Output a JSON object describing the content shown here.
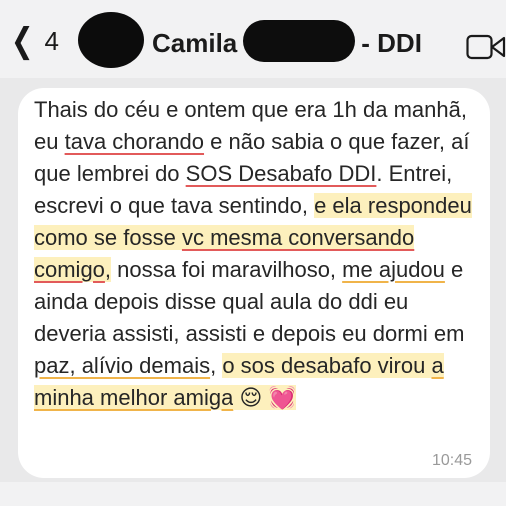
{
  "header": {
    "unread_count": "4",
    "contact_name_prefix": "Camila",
    "contact_name_suffix": "- DDI",
    "back_icon": "chevron-left-icon",
    "video_icon": "video-call-icon"
  },
  "message": {
    "seg1": "Thais do céu e ontem que era 1h da manhã, eu ",
    "seg2": "tava chorando",
    "seg3": " e não sabia o que fazer, aí que lembrei do ",
    "seg4": "SOS Desabafo DDI",
    "seg5": ". Entrei, escrevi o que tava sentindo, ",
    "seg6": "e ela respondeu como se fosse ",
    "seg7": "vc mesma conversando comigo",
    "seg8": ",",
    "seg9": " nossa foi maravilhoso, ",
    "seg10": "me ajudou",
    "seg11": " e ainda depois disse qual aula do ddi eu deveria assisti, assisti e depois eu dormi em ",
    "seg12": "paz, alívio demais",
    "seg13": ", ",
    "seg14": "o sos desabafo virou ",
    "seg15": "a minha melhor amiga",
    "seg16": " 😌 💓",
    "time": "10:45"
  },
  "colors": {
    "highlight": "#fdf0bd",
    "underline_red": "#e25a5a",
    "underline_orange": "#f0b44a"
  }
}
